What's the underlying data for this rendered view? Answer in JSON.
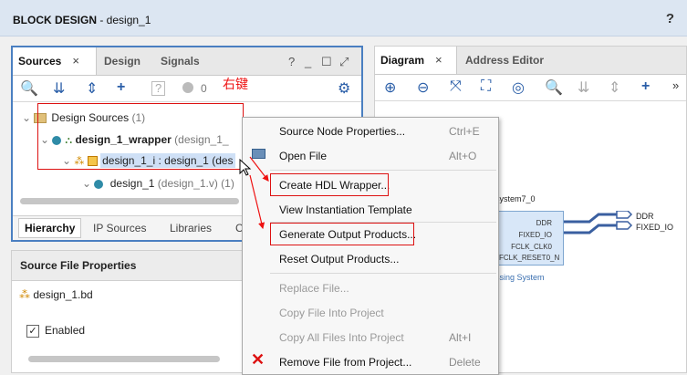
{
  "window": {
    "title_bold": "BLOCK DESIGN",
    "title_rest": " - design_1",
    "help": "?"
  },
  "sources": {
    "tabs": [
      "Sources",
      "Design",
      "Signals"
    ],
    "close": "×",
    "winctl": [
      "?",
      "_",
      "☐",
      "⤢"
    ],
    "toolbar": {
      "search": "🔍",
      "collapse": "⇊",
      "expand": "⇕",
      "add": "+",
      "info": "?",
      "status_count": "0",
      "gear": "⚙"
    },
    "tree": {
      "root": "Design Sources",
      "root_count": " (1)",
      "wrapper": "design_1_wrapper",
      "wrapper_detail": " (design_1_",
      "inst": "design_1_i : design_1",
      "inst_detail": " (des",
      "child": "design_1",
      "child_detail": " (design_1.v) (1)"
    },
    "bottom_tabs": [
      "Hierarchy",
      "IP Sources",
      "Libraries",
      "C"
    ]
  },
  "annotation": "右键",
  "properties": {
    "header": "Source File Properties",
    "file": "design_1.bd",
    "enabled_label": "Enabled",
    "enabled_check": "✓"
  },
  "diagram": {
    "tabs": [
      "Diagram",
      "Address Editor"
    ],
    "block_title": "system7_0",
    "block_subtitle": "ssing System",
    "ports": [
      "DDR",
      "FIXED_IO",
      "FCLK_CLK0",
      "FCLK_RESET0_N"
    ],
    "outputs": [
      "DDR",
      "FIXED_IO"
    ],
    "more": "»"
  },
  "menu": {
    "items": [
      {
        "label": "Source Node Properties...",
        "shortcut": "Ctrl+E"
      },
      {
        "label": "Open File",
        "shortcut": "Alt+O"
      },
      {
        "label": "Create HDL Wrapper...",
        "shortcut": ""
      },
      {
        "label": "View Instantiation Template",
        "shortcut": ""
      },
      {
        "label": "Generate Output Products...",
        "shortcut": ""
      },
      {
        "label": "Reset Output Products...",
        "shortcut": ""
      },
      {
        "label": "Replace File...",
        "shortcut": ""
      },
      {
        "label": "Copy File Into Project",
        "shortcut": ""
      },
      {
        "label": "Copy All Files Into Project",
        "shortcut": "Alt+I"
      },
      {
        "label": "Remove File from Project...",
        "shortcut": "Delete"
      }
    ]
  }
}
